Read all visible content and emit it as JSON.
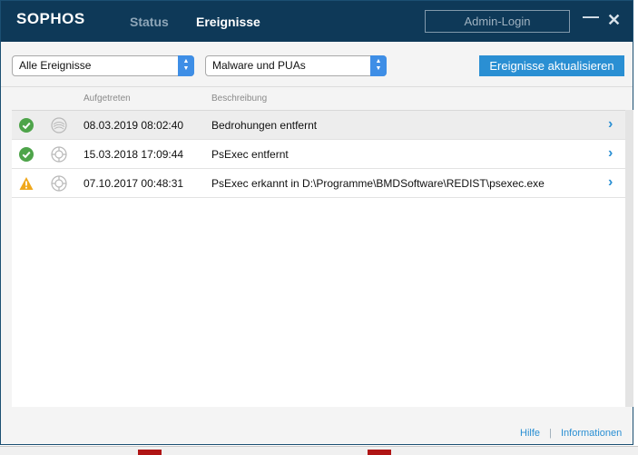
{
  "header": {
    "logo": "SOPHOS",
    "tabs": [
      {
        "label": "Status"
      },
      {
        "label": "Ereignisse"
      }
    ],
    "admin_login": "Admin-Login"
  },
  "toolbar": {
    "filter_events": "Alle Ereignisse",
    "filter_type": "Malware und PUAs",
    "refresh_label": "Ereignisse aktualisieren"
  },
  "table": {
    "columns": [
      "Aufgetreten",
      "Beschreibung"
    ],
    "rows": [
      {
        "status": "success-icon",
        "type": "threat-icon",
        "occurred": "08.03.2019 08:02:40",
        "description": "Bedrohungen entfernt"
      },
      {
        "status": "success-icon",
        "type": "target-icon",
        "occurred": "15.03.2018 17:09:44",
        "description": "PsExec entfernt"
      },
      {
        "status": "warning-icon",
        "type": "target-icon",
        "occurred": "07.10.2017 00:48:31",
        "description": "PsExec erkannt in D:\\Programme\\BMDSoftware\\REDIST\\psexec.exe"
      }
    ]
  },
  "footer": {
    "help": "Hilfe",
    "separator": "|",
    "info": "Informationen"
  },
  "colors": {
    "titlebar": "#0e3958",
    "accent": "#2a8fd3",
    "success": "#4ea44a",
    "warning": "#f0a81c"
  }
}
